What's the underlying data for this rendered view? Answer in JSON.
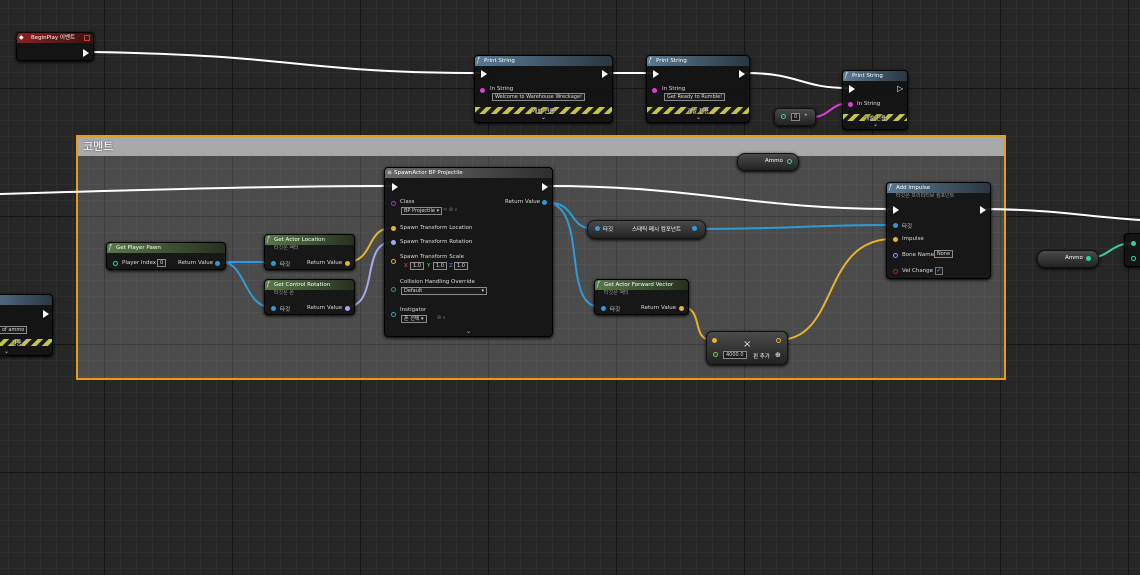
{
  "comment": {
    "title": "코멘트"
  },
  "begin_play": {
    "title": "BeginPlay 이벤트"
  },
  "print_1": {
    "title": "Print String",
    "in_string_label": "In String",
    "value": "Welcome to Warehouse Wreckage!",
    "dev_label": "개발 전용"
  },
  "print_2": {
    "title": "Print String",
    "in_string_label": "In String",
    "value": "Get Ready to Rumble!",
    "dev_label": "개발 전용"
  },
  "print_3": {
    "title": "Print String",
    "in_string_label": "In String",
    "dev_label": "개발 전용"
  },
  "left_partial": {
    "value": "of ammo",
    "dev_label": "전용"
  },
  "int_literal": {
    "value": "0"
  },
  "ammo_var_1": {
    "label": "Ammo"
  },
  "ammo_var_2": {
    "label": "Ammo"
  },
  "get_player_pawn": {
    "title": "Get Player Pawn",
    "player_index_label": "Player Index",
    "player_index": "0",
    "return_label": "Return Value"
  },
  "get_actor_location": {
    "title": "Get Actor Location",
    "subtitle": "타깃은 액터",
    "target_label": "타깃",
    "return_label": "Return Value"
  },
  "get_control_rotation": {
    "title": "Get Control Rotation",
    "subtitle": "타깃은 폰",
    "target_label": "타깃",
    "return_label": "Return Value"
  },
  "spawn_actor": {
    "title": "SpawnActor BP Projectile",
    "class_label": "Class",
    "class_value": "BP Projectile",
    "return_label": "Return Value",
    "loc_label": "Spawn Transform Location",
    "rot_label": "Spawn Transform Rotation",
    "scale_label": "Spawn Transform Scale",
    "scale_x_label": "X",
    "scale_y_label": "Y",
    "scale_z_label": "Z",
    "scale_x": "1.0",
    "scale_y": "1.0",
    "scale_z": "1.0",
    "collision_label": "Collision Handling Override",
    "collision_value": "Default",
    "instigator_label": "Instigator",
    "instigator_value": "폰 선택"
  },
  "static_mesh_cast": {
    "target_label": "타깃",
    "label": "스태틱 메시 컴포넌트"
  },
  "forward_vector": {
    "title": "Get Actor Forward Vector",
    "subtitle": "타깃은 액터",
    "target_label": "타깃",
    "return_label": "Return Value"
  },
  "multiply": {
    "symbol": "×",
    "value": "4000.0",
    "add_pin_label": "핀 추가"
  },
  "add_impulse": {
    "title": "Add Impulse",
    "subtitle": "타깃은 프리미티브 컴포넌트",
    "target_label": "타깃",
    "impulse_label": "Impulse",
    "bone_label": "Bone Name",
    "bone_value": "None",
    "vel_label": "Vel Change"
  },
  "colors": {
    "exec": "#ffffff",
    "object": "#2f9bd6",
    "vector": "#e3b42c",
    "rotator": "#a3a8f0",
    "integer": "#2fd3a3",
    "string": "#e33ad8",
    "comment_border": "#e89a1a"
  }
}
